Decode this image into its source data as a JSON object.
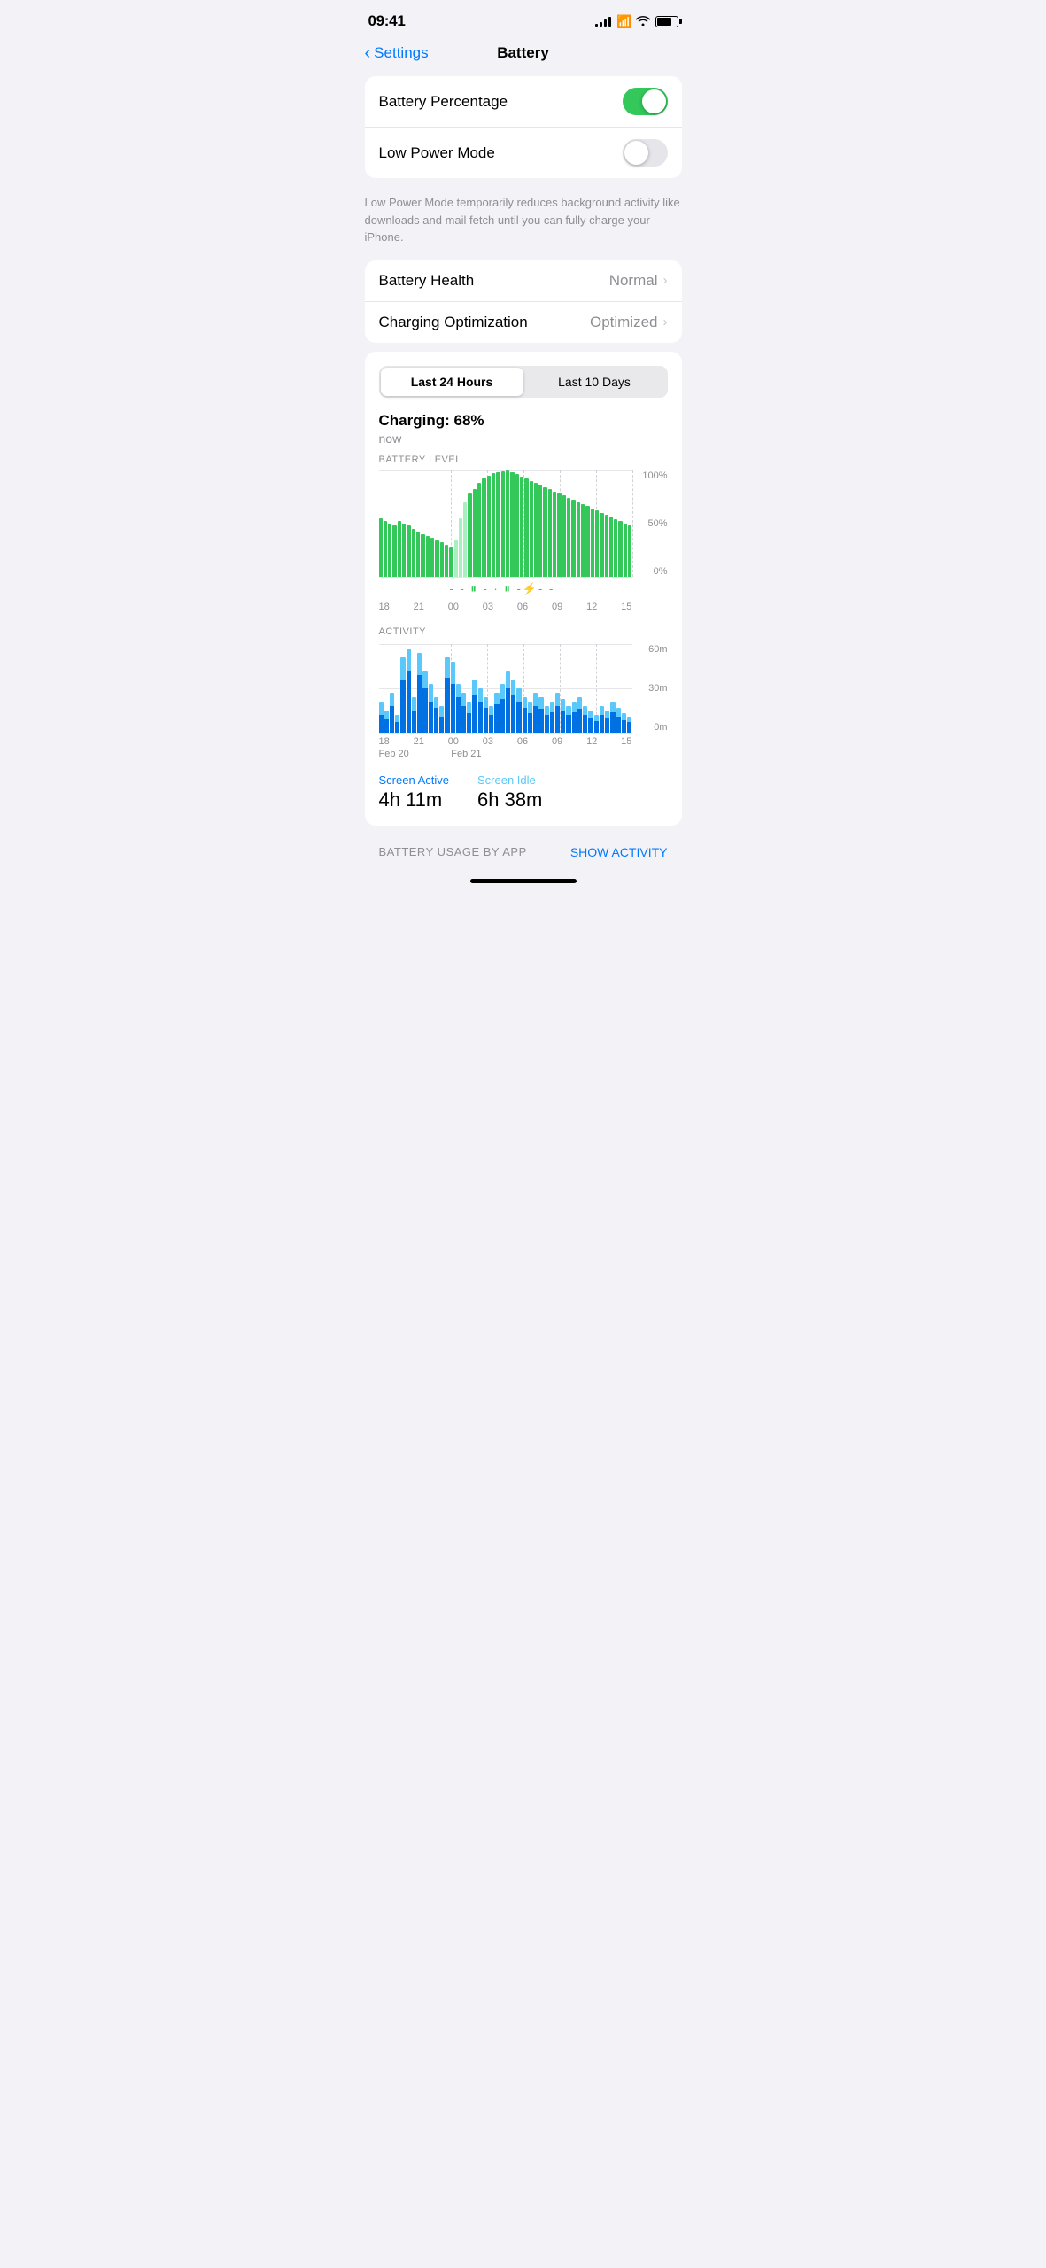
{
  "statusBar": {
    "time": "09:41",
    "battery": "75"
  },
  "nav": {
    "back": "Settings",
    "title": "Battery"
  },
  "settings": {
    "batteryPercentageLabel": "Battery Percentage",
    "batteryPercentageOn": true,
    "lowPowerModeLabel": "Low Power Mode",
    "lowPowerModeOn": false,
    "lowPowerNote": "Low Power Mode temporarily reduces background activity like downloads and mail fetch until you can fully charge your iPhone.",
    "batteryHealthLabel": "Battery Health",
    "batteryHealthValue": "Normal",
    "chargingOptLabel": "Charging Optimization",
    "chargingOptValue": "Optimized"
  },
  "chart": {
    "segmentActive": "Last 24 Hours",
    "segmentInactive": "Last 10 Days",
    "chargingLabel": "Charging: 68%",
    "chargingTime": "now",
    "batteryChartLabel": "BATTERY LEVEL",
    "axisLabels": [
      "100%",
      "50%",
      "0%"
    ],
    "timeLabels": [
      "18",
      "21",
      "00",
      "03",
      "06",
      "09",
      "12",
      "15"
    ],
    "activityChartLabel": "ACTIVITY",
    "activityAxisLabels": [
      "60m",
      "30m",
      "0m"
    ],
    "dateLabels": [
      "18",
      "21",
      "00",
      "03",
      "06",
      "09",
      "12",
      "15"
    ],
    "dateSubs": [
      "Feb 20",
      "",
      "Feb 21",
      "",
      "",
      "",
      "",
      ""
    ],
    "screenActiveLabel": "Screen Active",
    "screenActiveValue": "4h 11m",
    "screenIdleLabel": "Screen Idle",
    "screenIdleValue": "6h 38m",
    "batteryUsageLabel": "BATTERY USAGE BY APP",
    "showActivityLabel": "SHOW ACTIVITY"
  },
  "colors": {
    "green": "#34c759",
    "blue": "#007aff",
    "lightBlue": "#5ac8fa",
    "darkBlue": "#0066cc",
    "accent": "#007aff"
  }
}
